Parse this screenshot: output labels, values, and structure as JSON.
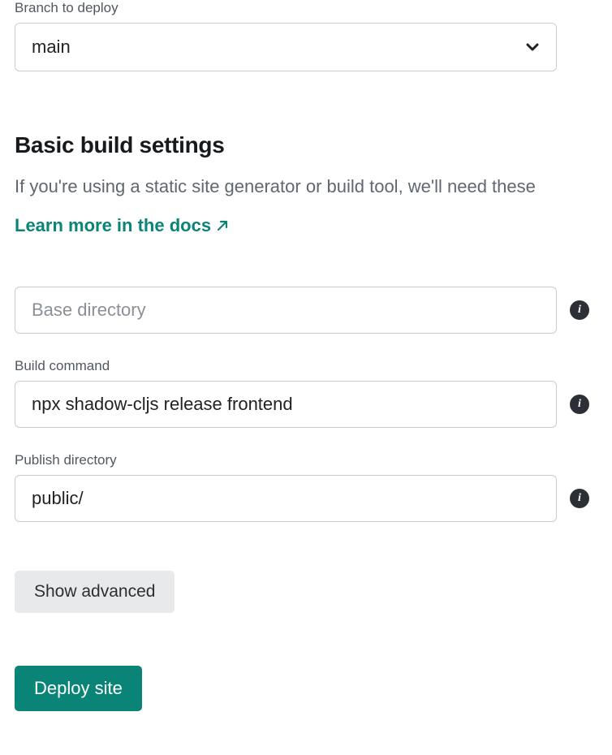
{
  "branch": {
    "label": "Branch to deploy",
    "value": "main"
  },
  "section": {
    "heading": "Basic build settings",
    "description": "If you're using a static site generator or build tool, we'll need these",
    "docs_link": "Learn more in the docs"
  },
  "fields": {
    "base_dir": {
      "placeholder": "Base directory",
      "value": ""
    },
    "build_cmd": {
      "label": "Build command",
      "value": "npx shadow-cljs release frontend"
    },
    "publish_dir": {
      "label": "Publish directory",
      "value": "public/"
    }
  },
  "buttons": {
    "show_advanced": "Show advanced",
    "deploy": "Deploy site"
  },
  "colors": {
    "accent": "#0b8478",
    "border": "#c9cdd3"
  }
}
